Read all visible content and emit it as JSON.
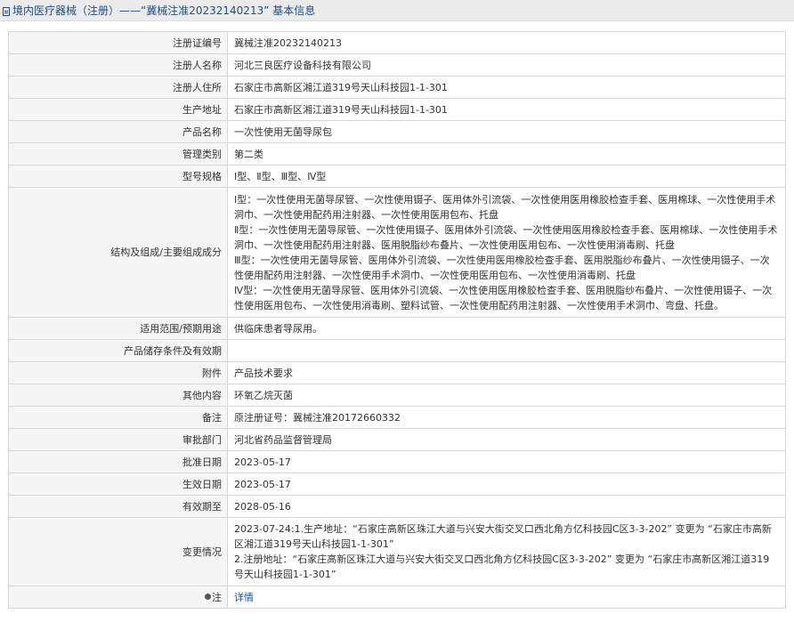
{
  "breadcrumb": {
    "category": "境内医疗器械（注册）",
    "separator": "——",
    "title": "“冀械注准20232140213” 基本信息"
  },
  "rows": [
    {
      "label": "注册证编号",
      "value": "冀械注准20232140213"
    },
    {
      "label": "注册人名称",
      "value": "河北三良医疗设备科技有限公司"
    },
    {
      "label": "注册人住所",
      "value": "石家庄市高新区湘江道319号天山科技园1-1-301"
    },
    {
      "label": "生产地址",
      "value": "石家庄市高新区湘江道319号天山科技园1-1-301"
    },
    {
      "label": "产品名称",
      "value": "一次性使用无菌导尿包"
    },
    {
      "label": "管理类别",
      "value": "第二类"
    },
    {
      "label": "型号规格",
      "value": "Ⅰ型、Ⅱ型、Ⅲ型、Ⅳ型"
    },
    {
      "label": "结构及组成/主要组成成分",
      "value": "Ⅰ型：一次性使用无菌导尿管、一次性使用镊子、医用体外引流袋、一次性使用医用橡胶检查手套、医用棉球、一次性使用手术洞巾、一次性使用配药用注射器、一次性使用医用包布、托盘\nⅡ型：一次性使用无菌导尿管、一次性使用镊子、医用体外引流袋、一次性使用医用橡胶检查手套、医用棉球、一次性使用手术洞巾、一次性使用配药用注射器、医用脱脂纱布叠片、一次性使用医用包布、一次性使用消毒刷、托盘\nⅢ型：一次性使用无菌导尿管、医用体外引流袋、一次性使用医用橡胶检查手套、医用脱脂纱布叠片、一次性使用镊子、一次性使用配药用注射器、一次性使用手术洞巾、一次性使用医用包布、一次性使用消毒刷、托盘\nⅣ型：一次性使用无菌导尿管、医用体外引流袋、一次性使用医用橡胶检查手套、医用脱脂纱布叠片、一次性使用镊子、一次性使用医用包布、一次性使用消毒刷、塑料试管、一次性使用配药用注射器、一次性使用手术洞巾、弯盘、托盘。"
    },
    {
      "label": "适用范围/预期用途",
      "value": "供临床患者导尿用。"
    },
    {
      "label": "产品储存条件及有效期",
      "value": ""
    },
    {
      "label": "附件",
      "value": "产品技术要求"
    },
    {
      "label": "其他内容",
      "value": "环氧乙烷灭菌"
    },
    {
      "label": "备注",
      "value": "原注册证号：冀械注准20172660332"
    },
    {
      "label": "审批部门",
      "value": "河北省药品监督管理局"
    },
    {
      "label": "批准日期",
      "value": "2023-05-17"
    },
    {
      "label": "生效日期",
      "value": "2023-05-17"
    },
    {
      "label": "有效期至",
      "value": "2028-05-16"
    },
    {
      "label": "变更情况",
      "value": "2023-07-24:1.生产地址：“石家庄高新区珠江大道与兴安大街交叉口西北角方亿科技园C区3-3-202” 变更为 “石家庄市高新区湘江道319号天山科技园1-1-301”\n2.注册地址：“石家庄高新区珠江大道与兴安大街交叉口西北角方亿科技园C区3-3-202” 变更为 “石家庄市高新区湘江道319号天山科技园1-1-301”"
    }
  ],
  "note_row": {
    "label": "注",
    "link_text": "详情",
    "icon": "bulb-icon"
  },
  "colors": {
    "link": "#1e4e8c",
    "label_bg": "#f5f5f5",
    "border": "#d6d6d6",
    "topbar_bg": "#ebebeb"
  }
}
